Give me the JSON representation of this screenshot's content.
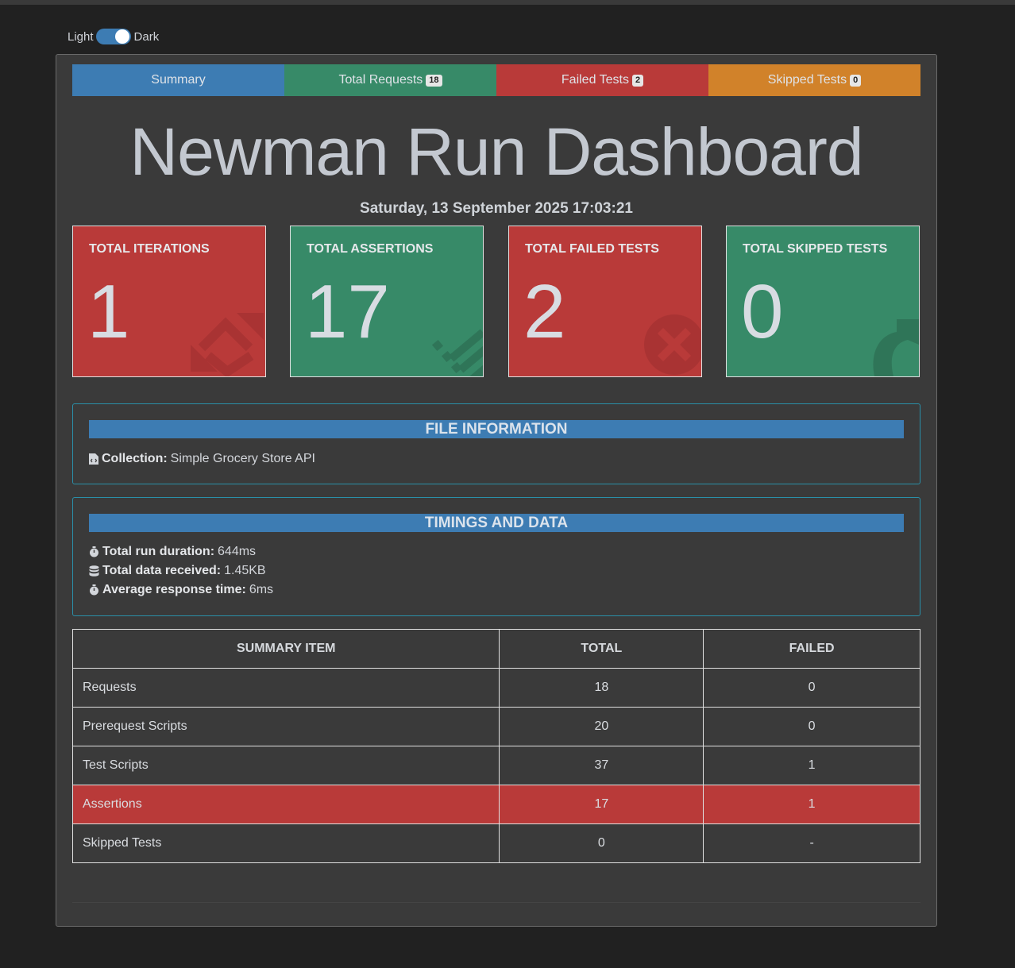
{
  "theme": {
    "light_label": "Light",
    "dark_label": "Dark"
  },
  "tabs": [
    {
      "label": "Summary",
      "badge": null
    },
    {
      "label": "Total Requests",
      "badge": "18"
    },
    {
      "label": "Failed Tests",
      "badge": "2"
    },
    {
      "label": "Skipped Tests",
      "badge": "0"
    }
  ],
  "title": "Newman Run Dashboard",
  "date": "Saturday, 13 September 2025 17:03:21",
  "cards": [
    {
      "label": "TOTAL ITERATIONS",
      "value": "1",
      "icon": "retweet-icon",
      "color": "#b93a39"
    },
    {
      "label": "TOTAL ASSERTIONS",
      "value": "17",
      "icon": "list-icon",
      "color": "#378a68"
    },
    {
      "label": "TOTAL FAILED TESTS",
      "value": "2",
      "icon": "times-circle-icon",
      "color": "#b93a39"
    },
    {
      "label": "TOTAL SKIPPED TESTS",
      "value": "0",
      "icon": "share-arrow-icon",
      "color": "#378a68"
    }
  ],
  "file_info": {
    "heading": "FILE INFORMATION",
    "collection_label": "Collection:",
    "collection_value": "Simple Grocery Store API"
  },
  "timings": {
    "heading": "TIMINGS AND DATA",
    "duration_label": "Total run duration:",
    "duration_value": "644ms",
    "data_label": "Total data received:",
    "data_value": "1.45KB",
    "avg_label": "Average response time:",
    "avg_value": "6ms"
  },
  "summary_table": {
    "headers": [
      "SUMMARY ITEM",
      "TOTAL",
      "FAILED"
    ],
    "rows": [
      [
        "Requests",
        "18",
        "0"
      ],
      [
        "Prerequest Scripts",
        "20",
        "0"
      ],
      [
        "Test Scripts",
        "37",
        "1"
      ],
      [
        "Assertions",
        "17",
        "1"
      ],
      [
        "Skipped Tests",
        "0",
        "-"
      ]
    ]
  },
  "colors": {
    "primary": "#3d7cb3",
    "success": "#378a68",
    "danger": "#b93a39",
    "warning": "#d1822a"
  }
}
